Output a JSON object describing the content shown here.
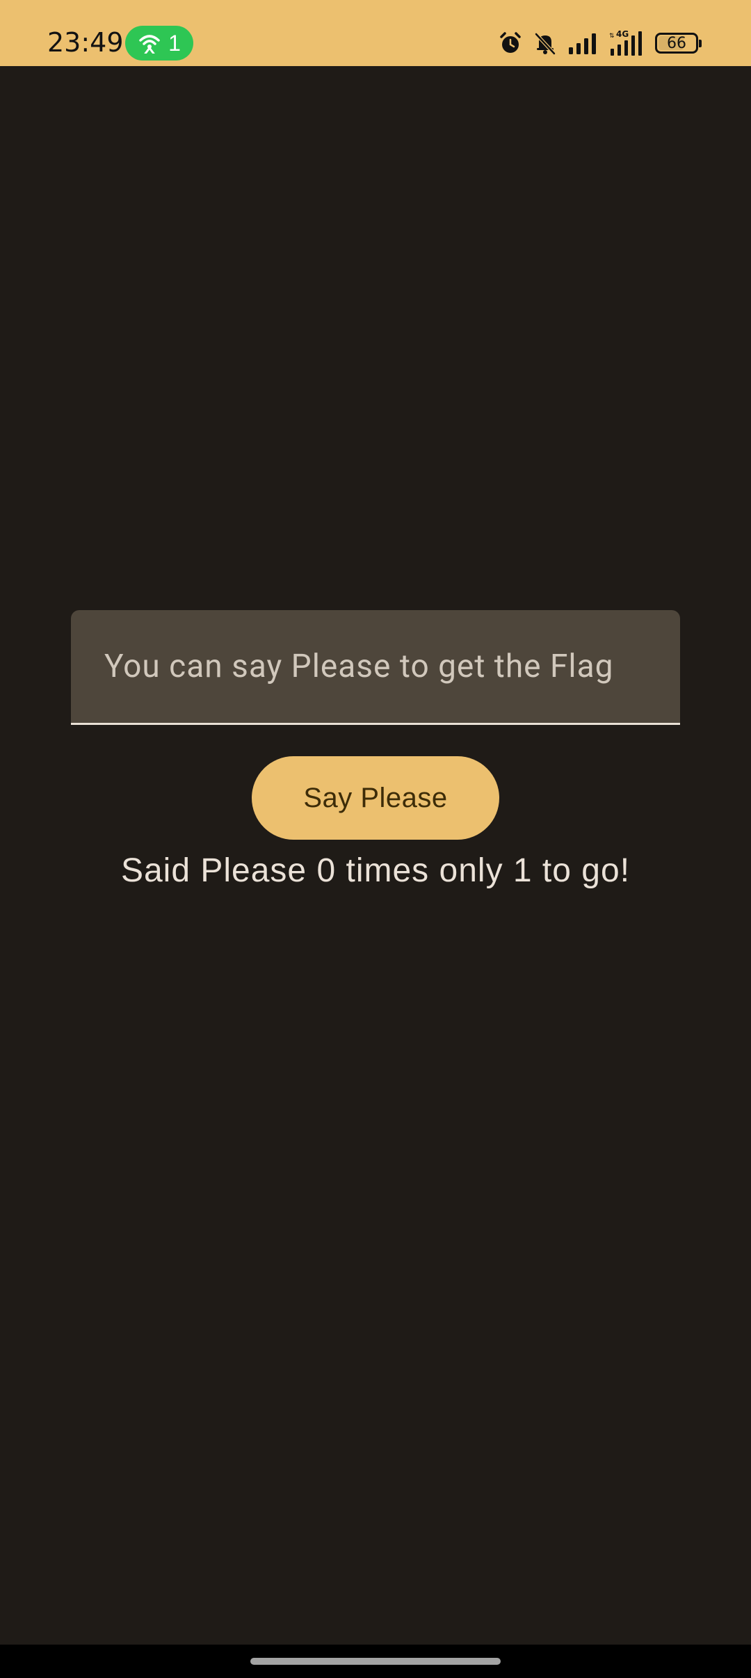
{
  "status_bar": {
    "time": "23:49",
    "hotspot_count": "1",
    "battery_level": "66",
    "network_label": "4G"
  },
  "main": {
    "text_field": {
      "value": "",
      "placeholder": "You can say Please to get the Flag"
    },
    "say_please_label": "Say Please",
    "counter_text": "Said Please 0 times only 1 to go!"
  },
  "colors": {
    "accent": "#ecc06f",
    "background": "#1f1b17",
    "field_background": "#4e463b",
    "hotspot_green": "#2ec654"
  }
}
